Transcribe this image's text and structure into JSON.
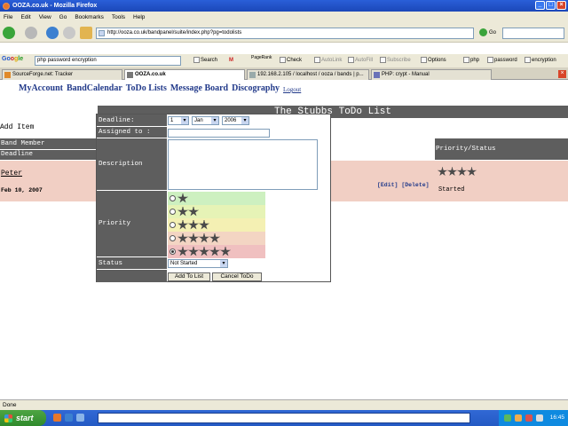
{
  "window": {
    "title": "OOZA.co.uk - Mozilla Firefox",
    "min": "_",
    "max": "□",
    "close": "×"
  },
  "menu": [
    "File",
    "Edit",
    "View",
    "Go",
    "Bookmarks",
    "Tools",
    "Help"
  ],
  "nav": {
    "url": "http://ooza.co.uk/bandpanel/suite/index.php?pg=todolists",
    "go_label": "Go"
  },
  "google_toolbar": {
    "logo": [
      "Go",
      "o",
      "g",
      "le"
    ],
    "query": "php password encryption",
    "search_label": "Search",
    "pagerank_label": "PageRank",
    "check_label": "Check",
    "autolink_label": "AutoLink",
    "autofill_label": "AutoFill",
    "subscribe_label": "Subscribe",
    "options_label": "Options",
    "terms": [
      "php",
      "password",
      "encryption"
    ]
  },
  "tabs": [
    {
      "label": "SourceForge.net: Tracker",
      "active": false
    },
    {
      "label": "OOZA.co.uk",
      "active": true
    },
    {
      "label": "192.168.2.105 / localhost / ooza / bands | p...",
      "active": false
    },
    {
      "label": "PHP: crypt - Manual",
      "active": false
    }
  ],
  "site_nav": {
    "items": [
      "MyAccount",
      "BandCalendar",
      "ToDo Lists",
      "Message Board",
      "Discography"
    ],
    "logout": "Logout"
  },
  "page_title": "The Stubbs ToDo List",
  "add_item_label": "Add Item",
  "columns": {
    "band_member": "Band Member",
    "deadline": "Deadline",
    "priority_status": "Priority/Status"
  },
  "row": {
    "member": "Peter",
    "deadline": "Feb 10, 2007",
    "edit": "[Edit]",
    "delete": "[Delete]",
    "priority": 4,
    "status": "Started"
  },
  "form": {
    "deadline_label": "Deadline:",
    "day": "1",
    "month": "Jan",
    "year": "2006",
    "assigned_label": "Assigned to :",
    "assigned_value": "",
    "description_label": "Description",
    "priority_label": "Priority",
    "priority_levels": [
      1,
      2,
      3,
      4,
      5
    ],
    "priority_selected": 5,
    "priority_colors": [
      "#cdf0c0",
      "#e6f3b6",
      "#f4f0b3",
      "#f3d5c3",
      "#f0c0c0"
    ],
    "status_label": "Status",
    "status_value": "Not Started",
    "add_button": "Add To List",
    "cancel_button": "Cancel ToDo"
  },
  "status_text": "Done",
  "taskbar": {
    "start": "start",
    "clock": "16:45"
  }
}
